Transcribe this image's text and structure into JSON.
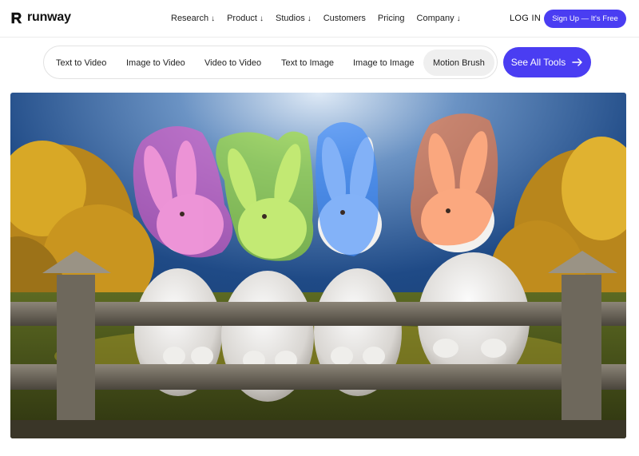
{
  "brand": {
    "name": "runway"
  },
  "nav": {
    "items": [
      {
        "label": "Research",
        "arrow": "↓"
      },
      {
        "label": "Product",
        "arrow": "↓"
      },
      {
        "label": "Studios",
        "arrow": "↓"
      },
      {
        "label": "Customers",
        "arrow": ""
      },
      {
        "label": "Pricing",
        "arrow": ""
      },
      {
        "label": "Company",
        "arrow": "↓"
      }
    ],
    "login_label": "LOG IN",
    "signup_label": "Sign Up — It's Free"
  },
  "tools": {
    "items": [
      {
        "label": "Text to Video",
        "active": false
      },
      {
        "label": "Image to Video",
        "active": false
      },
      {
        "label": "Video to Video",
        "active": false
      },
      {
        "label": "Text to Image",
        "active": false
      },
      {
        "label": "Image to Image",
        "active": false
      },
      {
        "label": "Motion Brush",
        "active": true
      }
    ],
    "see_all_label": "See All Tools",
    "see_all_icon": "arrow-right-icon"
  },
  "hero": {
    "description_icon": "motion-brush-demo-image",
    "colors": {
      "brush_pink": "#e85bc8",
      "brush_green": "#a6e62a",
      "brush_blue": "#3f8cff",
      "brush_orange": "#ff7a3a"
    }
  },
  "colors": {
    "accent": "#4a3df2"
  }
}
